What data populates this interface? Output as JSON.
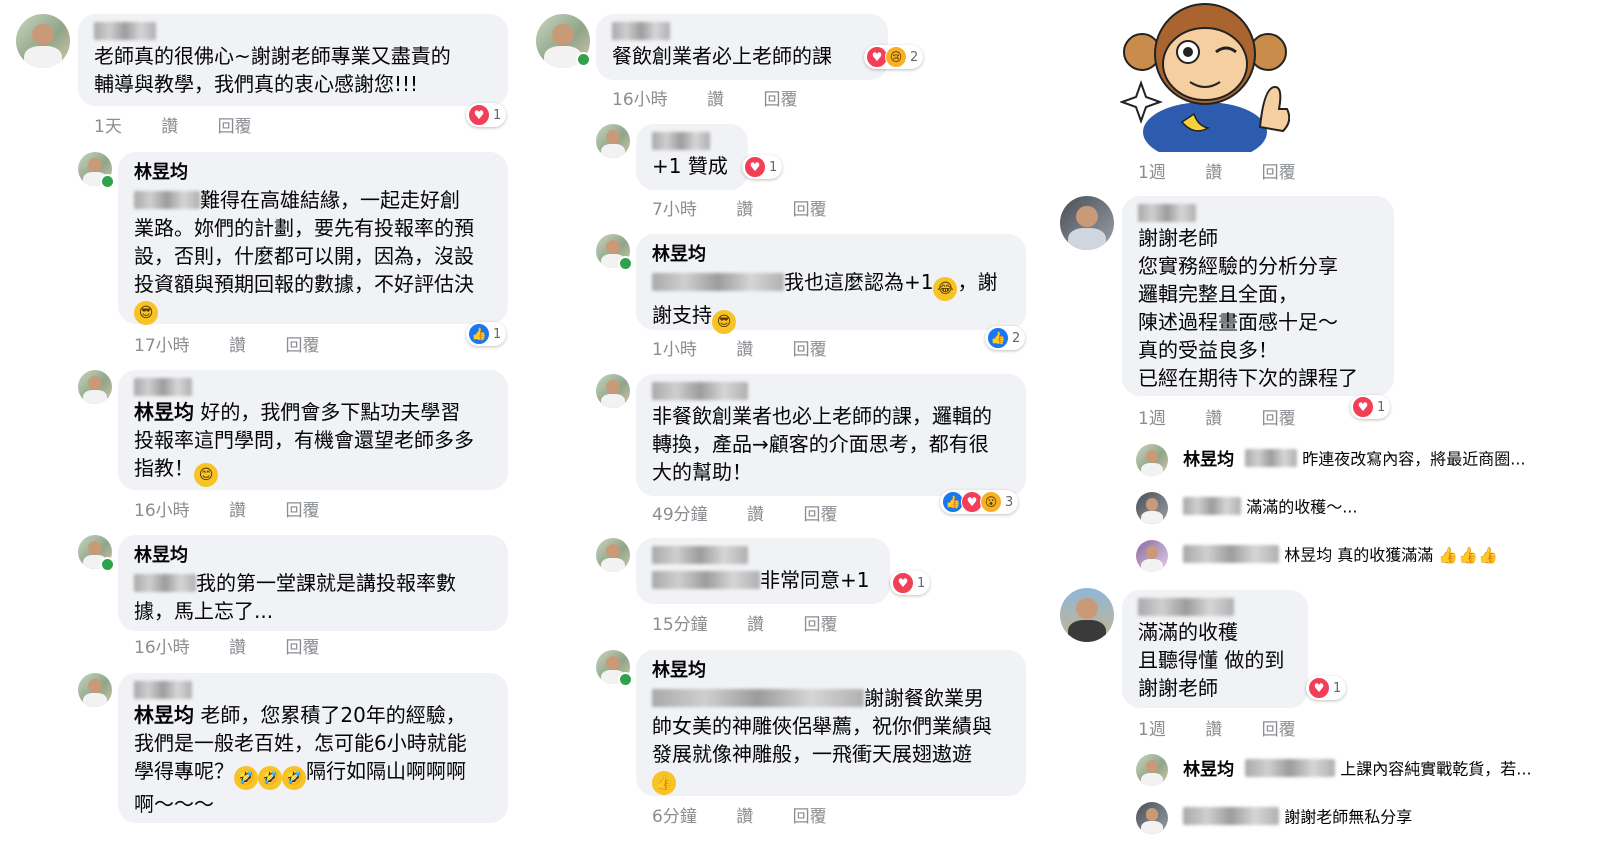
{
  "col1": {
    "c1": {
      "text1": "老師真的很佛心~謝謝老師專業又盡責的",
      "text2": "輔導與教學，我們真的衷心感謝您!!!",
      "time": "1天",
      "like": "讚",
      "reply": "回覆",
      "react_count": "1"
    },
    "c2": {
      "name": "林昱均",
      "text1": "難得在高雄結緣，一起走好創",
      "text2": "業路。妳們的計劃，要先有投報率的預",
      "text3": "設，否則，什麼都可以開，因為，沒設",
      "text4": "投資額與預期回報的數據，不好評估決",
      "time": "17小時",
      "like": "讚",
      "reply": "回覆",
      "react_count": "1"
    },
    "c3": {
      "mention": "林昱均",
      "text1": " 好的，我們會多下點功夫學習",
      "text2": "投報率這門學問，有機會還望老師多多",
      "text3": "指教！",
      "time": "16小時",
      "like": "讚",
      "reply": "回覆"
    },
    "c4": {
      "name": "林昱均",
      "text1": "我的第一堂課就是講投報率數",
      "text2": "據，馬上忘了...",
      "time": "16小時",
      "like": "讚",
      "reply": "回覆"
    },
    "c5": {
      "mention": "林昱均",
      "text1": " 老師，您累積了20年的經驗，",
      "text2": "我們是一般老百姓，怎可能6小時就能",
      "text3": "學得專呢？",
      "text3b": "隔行如隔山啊啊啊",
      "text4": "啊～～～"
    }
  },
  "col2": {
    "c1": {
      "text1": "餐飲創業者必上老師的課",
      "time": "16小時",
      "like": "讚",
      "reply": "回覆",
      "react_count": "2"
    },
    "c2": {
      "text1": "+1 贊成",
      "time": "7小時",
      "like": "讚",
      "reply": "回覆",
      "react_count": "1"
    },
    "c3": {
      "name": "林昱均",
      "text1": "我也這麼認為+1",
      "text1b": "，謝",
      "text2": "謝支持",
      "time": "1小時",
      "like": "讚",
      "reply": "回覆",
      "react_count": "2"
    },
    "c4": {
      "text1": "非餐飲創業者也必上老師的課，邏輯的",
      "text2": "轉換，產品→顧客的介面思考，都有很",
      "text3": "大的幫助！",
      "time": "49分鐘",
      "like": "讚",
      "reply": "回覆",
      "react_count": "3"
    },
    "c5": {
      "text1": "非常同意+1",
      "time": "15分鐘",
      "like": "讚",
      "reply": "回覆",
      "react_count": "1"
    },
    "c6": {
      "name": "林昱均",
      "text1": "謝謝餐飲業男",
      "text2": "帥女美的神雕俠侶舉薦，祝你們業績與",
      "text3": "發展就像神雕般，一飛衝天展翅遨遊",
      "time": "6分鐘",
      "like": "讚",
      "reply": "回覆"
    }
  },
  "col3": {
    "sticker_meta": {
      "time": "1週",
      "like": "讚",
      "reply": "回覆"
    },
    "c1": {
      "text1": "謝謝老師",
      "text2": "您實務經驗的分析分享",
      "text3": "邏輯完整且全面，",
      "text4": "陳述過程畫面感十足～",
      "text5": "真的受益良多！",
      "text6": "已經在期待下次的課程了",
      "time": "1週",
      "like": "讚",
      "reply": "回覆",
      "react_count": "1"
    },
    "r1": {
      "name": "林昱均",
      "text": "昨連夜改寫內容，將最近商圈..."
    },
    "r2": {
      "text": "滿滿的收穫～..."
    },
    "r3": {
      "text": "林昱均 真的收獲滿滿"
    },
    "c2": {
      "text1": "滿滿的收穫",
      "text2": "且聽得懂 做的到",
      "text3": "謝謝老師",
      "time": "1週",
      "like": "讚",
      "reply": "回覆",
      "react_count": "1"
    },
    "r4": {
      "name": "林昱均",
      "text": "上課內容純實戰乾貨，若..."
    },
    "r5": {
      "text": "謝謝老師無私分享"
    }
  },
  "colors": {
    "bubble": "#f0f2f5",
    "meta": "#8a8d91",
    "heart": "#f33e58",
    "like": "#1877f2",
    "online": "#31a24c"
  }
}
